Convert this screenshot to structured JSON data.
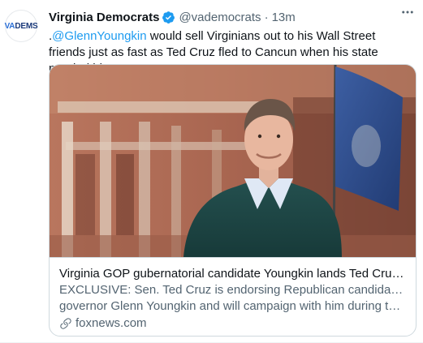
{
  "account": {
    "name": "Virginia Democrats",
    "handle": "@vademocrats",
    "separator": "·",
    "time": "13m",
    "avatar_text_prefix": "VA",
    "avatar_text_suffix": "DEMS"
  },
  "tweet": {
    "lead": ".",
    "mention": "@GlennYoungkin",
    "body": " would sell Virginians out to his Wall Street friends just as fast as Ted Cruz fled to Cancun when his state needed him."
  },
  "card": {
    "title": "Virginia GOP gubernatorial candidate Youngkin lands Ted Cruz endors...",
    "description_line1": "EXCLUSIVE: Sen. Ted Cruz is endorsing Republican candidate for Virginia",
    "description_line2": "governor Glenn Youngkin and will campaign with him during the final ...",
    "domain": "foxnews.com"
  },
  "colors": {
    "accent": "#1d9bf0",
    "muted": "#536471",
    "text": "#0f1419",
    "border": "#cfd9de"
  },
  "icons": {
    "more": "more-horizontal-icon",
    "verified": "verified-badge-icon",
    "link": "link-icon"
  }
}
